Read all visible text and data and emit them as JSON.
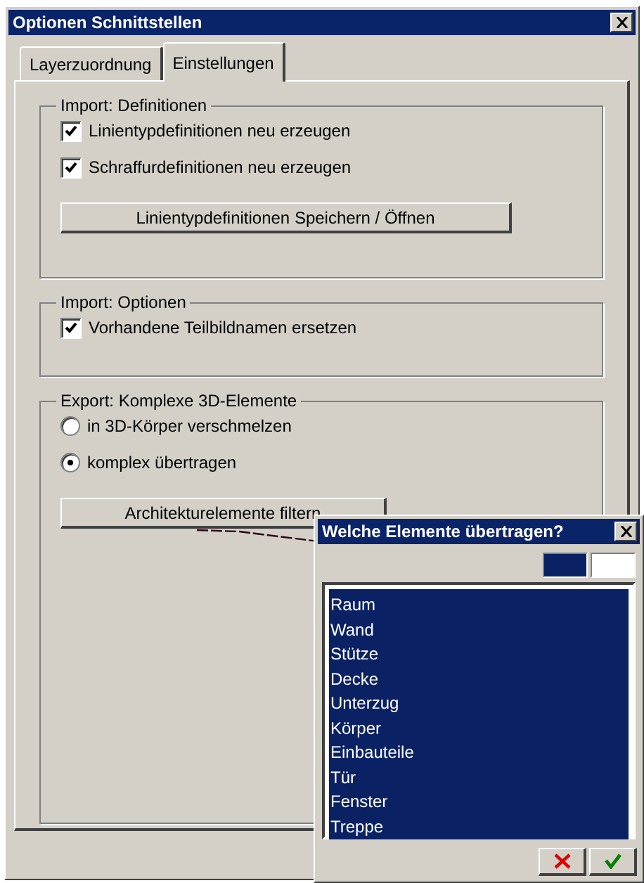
{
  "window": {
    "title": "Optionen Schnittstellen"
  },
  "tabs": [
    {
      "label": "Layerzuordnung",
      "selected": false
    },
    {
      "label": "Einstellungen",
      "selected": true
    }
  ],
  "groups": [
    {
      "title": "Import: Definitionen",
      "items": [
        {
          "kind": "checkbox",
          "label": "Linientypdefinitionen neu erzeugen",
          "checked": true
        },
        {
          "kind": "checkbox",
          "label": "Schraffurdefinitionen neu erzeugen",
          "checked": true
        },
        {
          "kind": "button",
          "label": "Linientypdefinitionen Speichern / Öffnen"
        }
      ]
    },
    {
      "title": "Import: Optionen",
      "items": [
        {
          "kind": "checkbox",
          "label": "Vorhandene Teilbildnamen ersetzen",
          "checked": true
        }
      ]
    },
    {
      "title": "Export: Komplexe 3D-Elemente",
      "items": [
        {
          "kind": "radio",
          "label": "in 3D-Körper verschmelzen",
          "selected": false
        },
        {
          "kind": "radio",
          "label": "komplex übertragen",
          "selected": true
        },
        {
          "kind": "button",
          "label": "Architekturelemente filtern"
        }
      ]
    }
  ],
  "popup": {
    "title": "Welche Elemente übertragen?",
    "swatches": [
      {
        "color": "#0a2164"
      },
      {
        "color": "#ffffff"
      }
    ],
    "items": [
      {
        "label": "Raum",
        "selected": true
      },
      {
        "label": "Wand",
        "selected": true
      },
      {
        "label": "Stütze",
        "selected": true
      },
      {
        "label": "Decke",
        "selected": true
      },
      {
        "label": "Unterzug",
        "selected": true
      },
      {
        "label": "Körper",
        "selected": true
      },
      {
        "label": "Einbauteile",
        "selected": true
      },
      {
        "label": "Tür",
        "selected": true
      },
      {
        "label": "Fenster",
        "selected": true
      },
      {
        "label": "Treppe",
        "selected": true
      }
    ]
  }
}
